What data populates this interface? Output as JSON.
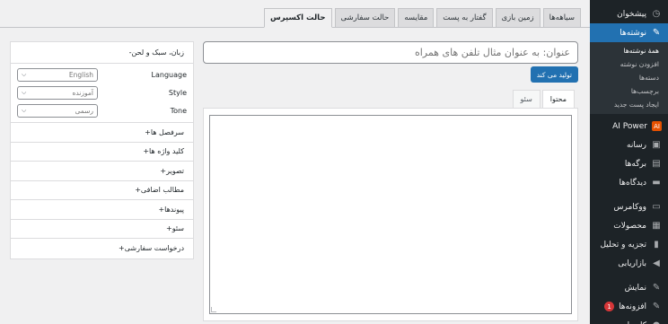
{
  "sidebar": {
    "items": [
      {
        "label": "پیشخوان",
        "icon": "dashboard-icon",
        "glyph": "◷"
      },
      {
        "label": "نوشته‌ها",
        "icon": "pin-icon",
        "glyph": "✎",
        "active": true
      }
    ],
    "sub": [
      "همهٔ نوشته‌ها",
      "افزودن نوشته",
      "دسته‌ها",
      "برچسب‌ها",
      "ایجاد پست جدید"
    ],
    "items2": [
      {
        "label": "AI Power",
        "icon": "ai-power-icon",
        "glyph": "AI"
      },
      {
        "label": "رسانه",
        "icon": "media-icon",
        "glyph": "▣"
      },
      {
        "label": "برگه‌ها",
        "icon": "pages-icon",
        "glyph": "▤"
      },
      {
        "label": "دیدگاه‌ها",
        "icon": "comments-icon",
        "glyph": "▬"
      }
    ],
    "items3": [
      {
        "label": "ووکامرس",
        "icon": "woo-icon",
        "glyph": "▭"
      },
      {
        "label": "محصولات",
        "icon": "products-icon",
        "glyph": "▦"
      },
      {
        "label": "تجزیه و تحلیل",
        "icon": "analytics-icon",
        "glyph": "▮"
      },
      {
        "label": "بازاریابی",
        "icon": "marketing-icon",
        "glyph": "◀"
      }
    ],
    "items4": [
      {
        "label": "نمایش",
        "icon": "appearance-icon",
        "glyph": "✎"
      },
      {
        "label": "افزونه‌ها",
        "icon": "plugins-icon",
        "glyph": "✎",
        "badge": "1"
      },
      {
        "label": "کاربران",
        "icon": "users-icon",
        "glyph": "●"
      }
    ]
  },
  "tabs": [
    "حالت اکسپرس",
    "حالت سفارشی",
    "مقایسه",
    "گفتار به پست",
    "زمین بازی",
    "سیاهه‌ها"
  ],
  "title_placeholder": "عنوان: به عنوان مثال تلفن های همراه",
  "generate_label": "تولید می کند",
  "editor_tabs": [
    "محتوا",
    "سئو"
  ],
  "panel": {
    "header": "-زبان، سبک و لحن",
    "settings": [
      {
        "label": "Language",
        "value": "English"
      },
      {
        "label": "Style",
        "value": "آموزنده"
      },
      {
        "label": "Tone",
        "value": "رسمی"
      }
    ],
    "accordions": [
      "+سرفصل ها",
      "+کلید واژه ها",
      "+تصویر",
      "+مطالب اضافی",
      "+پیوندها",
      "+سئو",
      "+درخواست سفارشی"
    ]
  }
}
